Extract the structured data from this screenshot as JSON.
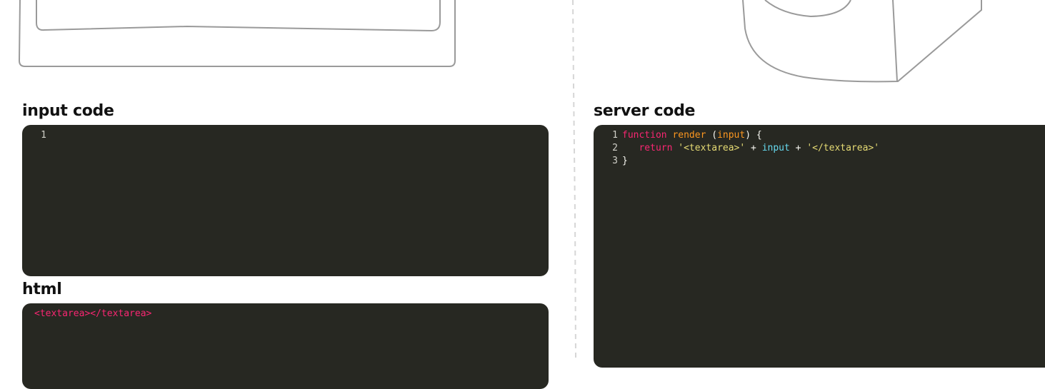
{
  "colors": {
    "editor_bg": "#272822",
    "gutter_text": "#d0d0c8",
    "keyword": "#f92672",
    "function_name": "#fd971f",
    "param": "#fd971f",
    "plain": "#f8f8f2",
    "string": "#e6db74",
    "variable": "#66d9ef",
    "html_tag": "#f92672",
    "sketch_stroke": "#9a9a9a"
  },
  "input_panel": {
    "title": "input code",
    "line_number": "1",
    "value": ""
  },
  "html_panel": {
    "title": "html",
    "output": "<textarea></textarea>"
  },
  "server_panel": {
    "title": "server code",
    "lines": [
      {
        "number": "1",
        "tokens": [
          {
            "text": "function",
            "kind": "keyword"
          },
          {
            "text": " ",
            "kind": "plain"
          },
          {
            "text": "render",
            "kind": "function_name"
          },
          {
            "text": " (",
            "kind": "plain"
          },
          {
            "text": "input",
            "kind": "param"
          },
          {
            "text": ") {",
            "kind": "plain"
          }
        ]
      },
      {
        "number": "2",
        "tokens": [
          {
            "text": "   ",
            "kind": "plain"
          },
          {
            "text": "return",
            "kind": "keyword"
          },
          {
            "text": " ",
            "kind": "plain"
          },
          {
            "text": "'<textarea>'",
            "kind": "string"
          },
          {
            "text": " + ",
            "kind": "plain"
          },
          {
            "text": "input",
            "kind": "variable"
          },
          {
            "text": " + ",
            "kind": "plain"
          },
          {
            "text": "'</textarea>'",
            "kind": "string"
          }
        ]
      },
      {
        "number": "3",
        "tokens": [
          {
            "text": "}",
            "kind": "plain"
          }
        ]
      }
    ]
  }
}
